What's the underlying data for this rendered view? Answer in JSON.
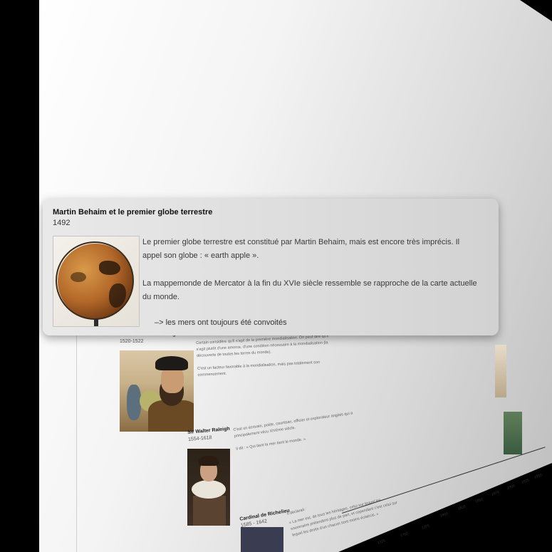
{
  "popup": {
    "title": "Martin Behaim et le premier globe terrestre",
    "year": "1492",
    "paragraph_1": "Le premier globe terrestre est constitué par Martin Behaim, mais est encore très imprécis. Il appel son globe : « earth apple ».",
    "paragraph_2": "La mappemonde de Mercator à la fin du XVIe siècle ressemble se rapproche de la carte actuelle du monde.",
    "link": "–> les mers ont toujours été convoités"
  },
  "timeline": {
    "entries": [
      {
        "title": "Circumterrestre de Magellan",
        "years": "1520-1522",
        "text_1": "Certain considère qu'il s'agit de la première mondialisation. On peut dire qu'il s'agit plutôt d'une amorce, d'une condition nécessaire à la mondialisation (la découverte de toutes les terres du monde).",
        "text_2": "C'est un facteur favorable à la mondialisation, mais pas totalement son commencement."
      },
      {
        "title": "Sir Walter Raleigh",
        "years": "1554-1618",
        "text_1": "C'est un écrivain, poète, courtisan, officier et explorateur anglais qui a principalement vécu XIVème siècle.",
        "text_2": "Il dit : « Qui tient la mer tient le monde. »"
      },
      {
        "title": "Cardinal de Richelieu",
        "years": "1585 - 1642",
        "text_1": "Il déclarait :",
        "text_2": "« La mer est, de tous les héritages, celui sur lequel les souverains prétendent plus de part, et cependant c'est celui sur lequel les droits d'un chacun sont moins éclaircis. »"
      }
    ],
    "axis_ticks": [
      "1725",
      "1750",
      "1775",
      "1800",
      "1825",
      "1850",
      "1875",
      "1900",
      "1925",
      "1950",
      "1975",
      "2000",
      "2025"
    ]
  }
}
